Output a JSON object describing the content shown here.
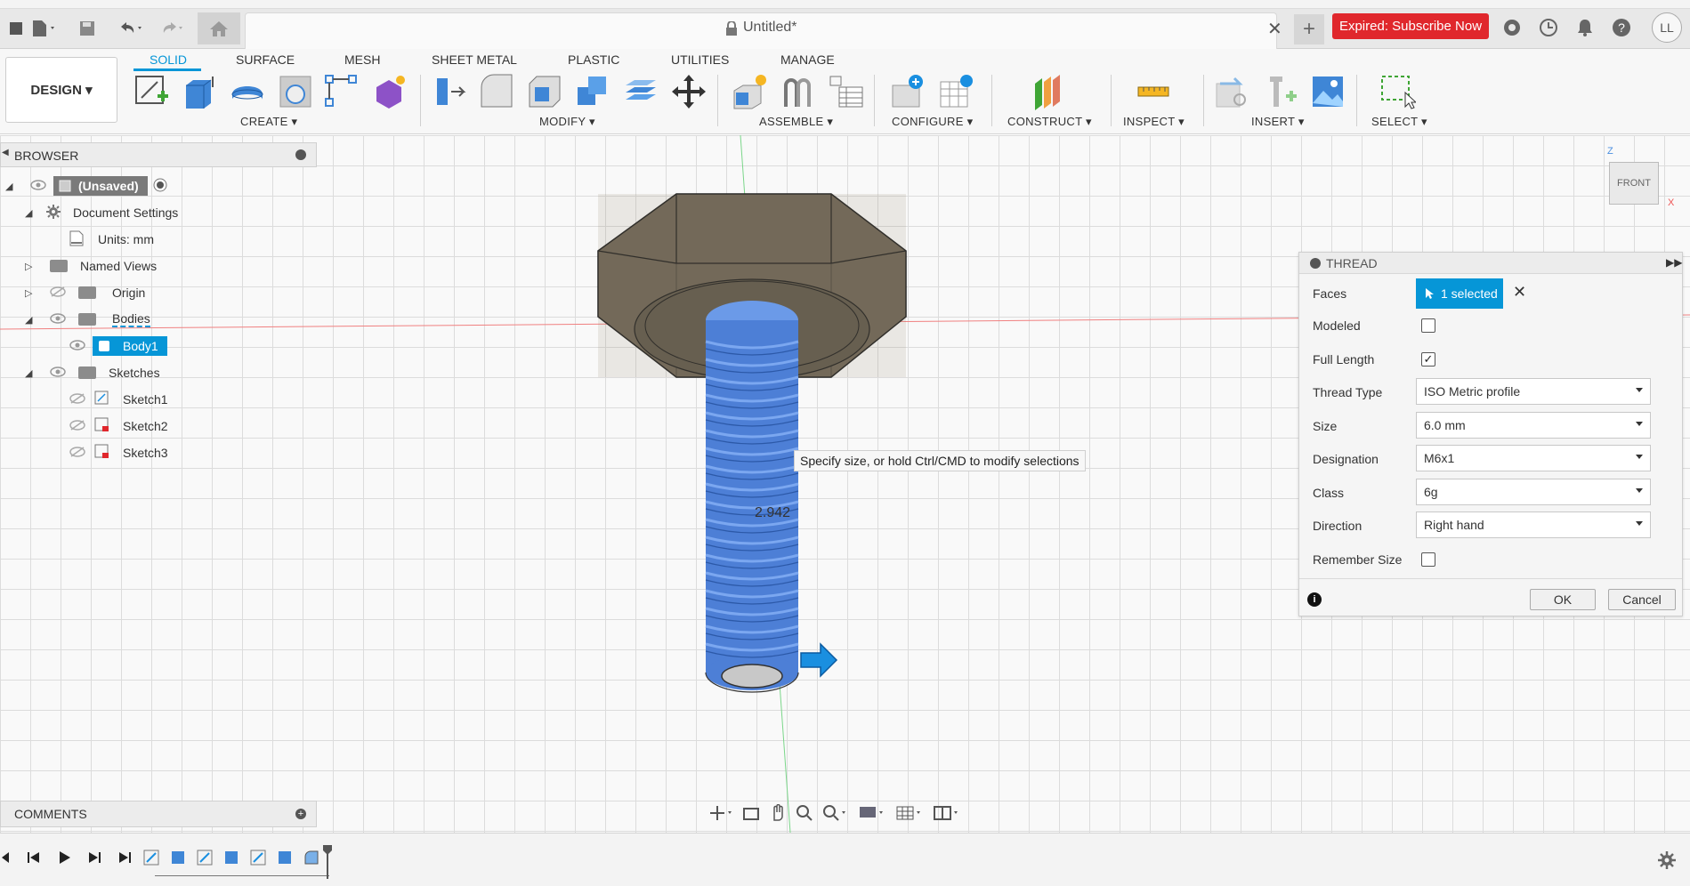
{
  "window": {
    "title": "Untitled*"
  },
  "header": {
    "expired_button": "Expired: Subscribe Now",
    "avatar": "LL"
  },
  "ribbon": {
    "workspace_button": "DESIGN ▾",
    "tabs": [
      "SOLID",
      "SURFACE",
      "MESH",
      "SHEET METAL",
      "PLASTIC",
      "UTILITIES",
      "MANAGE"
    ],
    "groups": [
      "CREATE ▾",
      "MODIFY ▾",
      "ASSEMBLE ▾",
      "CONFIGURE ▾",
      "CONSTRUCT ▾",
      "INSPECT ▾",
      "INSERT ▾",
      "SELECT ▾"
    ]
  },
  "browser": {
    "title": "BROWSER",
    "items": [
      {
        "label": "(Unsaved)"
      },
      {
        "label": "Document Settings"
      },
      {
        "label": "Units: mm"
      },
      {
        "label": "Named Views"
      },
      {
        "label": "Origin"
      },
      {
        "label": "Bodies"
      },
      {
        "label": "Body1"
      },
      {
        "label": "Sketches"
      },
      {
        "label": "Sketch1"
      },
      {
        "label": "Sketch2"
      },
      {
        "label": "Sketch3"
      }
    ]
  },
  "viewport": {
    "tooltip": "Specify size, or hold Ctrl/CMD to modify selections",
    "dimension": "2.942",
    "viewcube_label": "FRONT",
    "axis_z": "Z",
    "axis_x": "X"
  },
  "thread": {
    "title": "THREAD",
    "faces_label": "Faces",
    "faces_value": "1 selected",
    "modeled_label": "Modeled",
    "modeled_checked": false,
    "full_length_label": "Full Length",
    "full_length_checked": true,
    "thread_type_label": "Thread Type",
    "thread_type_value": "ISO Metric profile",
    "size_label": "Size",
    "size_value": "6.0 mm",
    "designation_label": "Designation",
    "designation_value": "M6x1",
    "class_label": "Class",
    "class_value": "6g",
    "direction_label": "Direction",
    "direction_value": "Right hand",
    "remember_label": "Remember Size",
    "remember_checked": false,
    "ok": "OK",
    "cancel": "Cancel"
  },
  "comments": {
    "title": "COMMENTS"
  },
  "colors": {
    "accent": "#0696d7",
    "expired": "#e0272c",
    "selection": "#0696d7",
    "thread_body": "#4d7fd6"
  }
}
